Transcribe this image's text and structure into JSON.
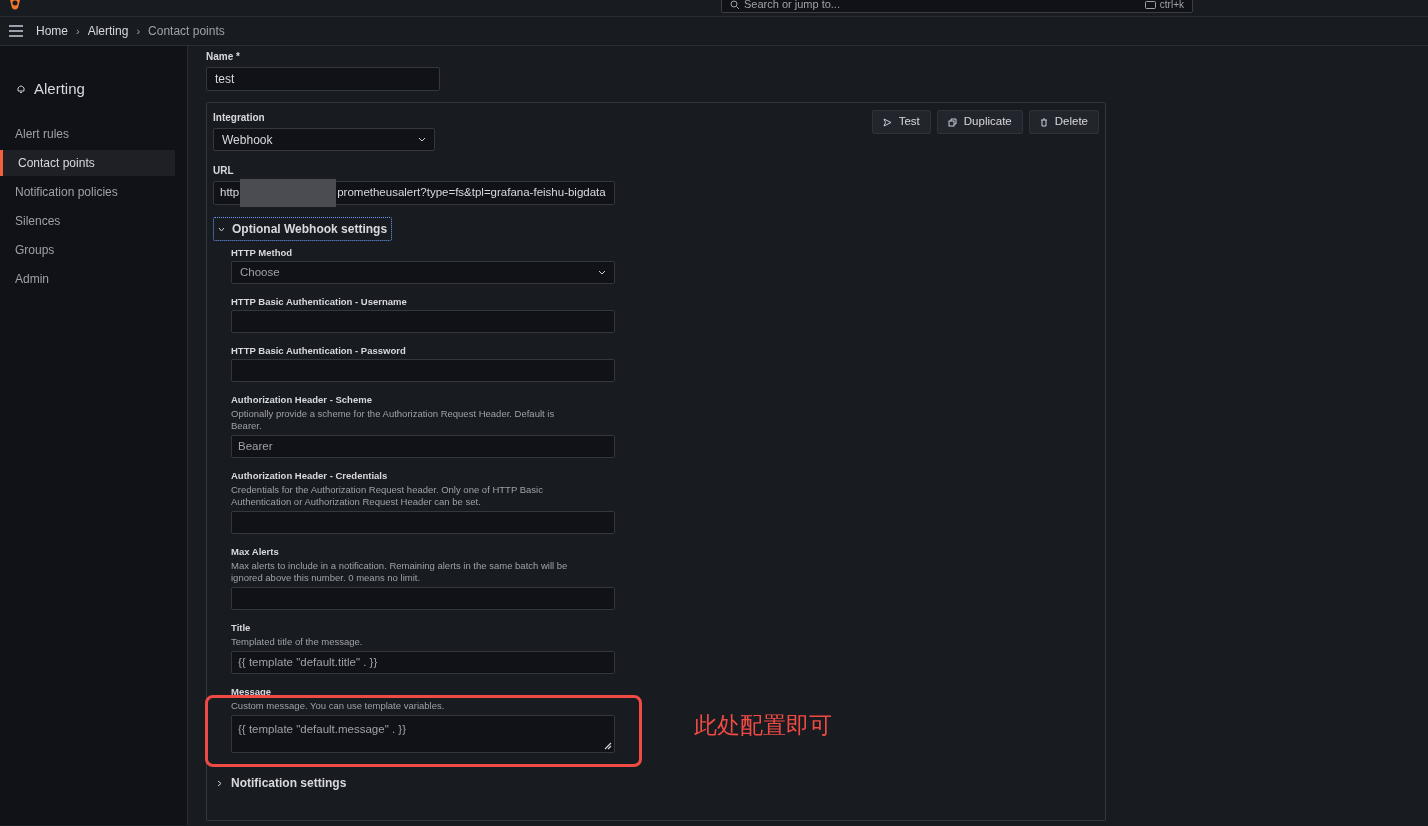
{
  "topbar": {
    "search_placeholder": "Search or jump to...",
    "shortcut": "ctrl+k"
  },
  "breadcrumbs": [
    {
      "label": "Home",
      "kind": "link"
    },
    {
      "label": "›",
      "kind": "separator"
    },
    {
      "label": "Alerting",
      "kind": "link"
    },
    {
      "label": "›",
      "kind": "separator"
    },
    {
      "label": "Contact points",
      "kind": "current"
    }
  ],
  "sidebar": {
    "title": "Alerting",
    "items": [
      {
        "label": "Alert rules",
        "selected": false
      },
      {
        "label": "Contact points",
        "selected": true
      },
      {
        "label": "Notification policies",
        "selected": false
      },
      {
        "label": "Silences",
        "selected": false
      },
      {
        "label": "Groups",
        "selected": false
      },
      {
        "label": "Admin",
        "selected": false
      }
    ]
  },
  "name_field": {
    "label": "Name *",
    "value": "test"
  },
  "integration": {
    "label": "Integration",
    "value": "Webhook",
    "buttons": [
      {
        "label": "Test",
        "kind": "send"
      },
      {
        "label": "Duplicate",
        "kind": "copy"
      },
      {
        "label": "Delete",
        "kind": "trash"
      }
    ],
    "url": {
      "label": "URL",
      "value_start": "http",
      "value_end": "prometheusalert?type=fs&tpl=grafana-feishu-bigdata"
    },
    "optional_section": {
      "title": "Optional Webhook settings",
      "expanded": true,
      "fields": [
        {
          "kind": "select",
          "label": "HTTP Method",
          "placeholder": "Choose"
        },
        {
          "kind": "input",
          "label": "HTTP Basic Authentication - Username"
        },
        {
          "kind": "input",
          "label": "HTTP Basic Authentication - Password"
        },
        {
          "kind": "input",
          "label": "Authorization Header - Scheme",
          "description": "Optionally provide a scheme for the Authorization Request Header. Default is Bearer.",
          "placeholder": "Bearer"
        },
        {
          "kind": "input",
          "label": "Authorization Header - Credentials",
          "description": "Credentials for the Authorization Request header. Only one of HTTP Basic Authentication or Authorization Request Header can be set."
        },
        {
          "kind": "input",
          "label": "Max Alerts",
          "description": "Max alerts to include in a notification. Remaining alerts in the same batch will be ignored above this number. 0 means no limit."
        },
        {
          "kind": "input",
          "label": "Title",
          "description": "Templated title of the message.",
          "placeholder": "{{ template \"default.title\" . }}"
        },
        {
          "kind": "textarea",
          "label": "Message",
          "description": "Custom message. You can use template variables.",
          "placeholder": "{{ template \"default.message\" . }}"
        }
      ]
    },
    "notification_section": {
      "title": "Notification settings",
      "expanded": false
    }
  },
  "annotation": {
    "text": "此处配置即可"
  }
}
